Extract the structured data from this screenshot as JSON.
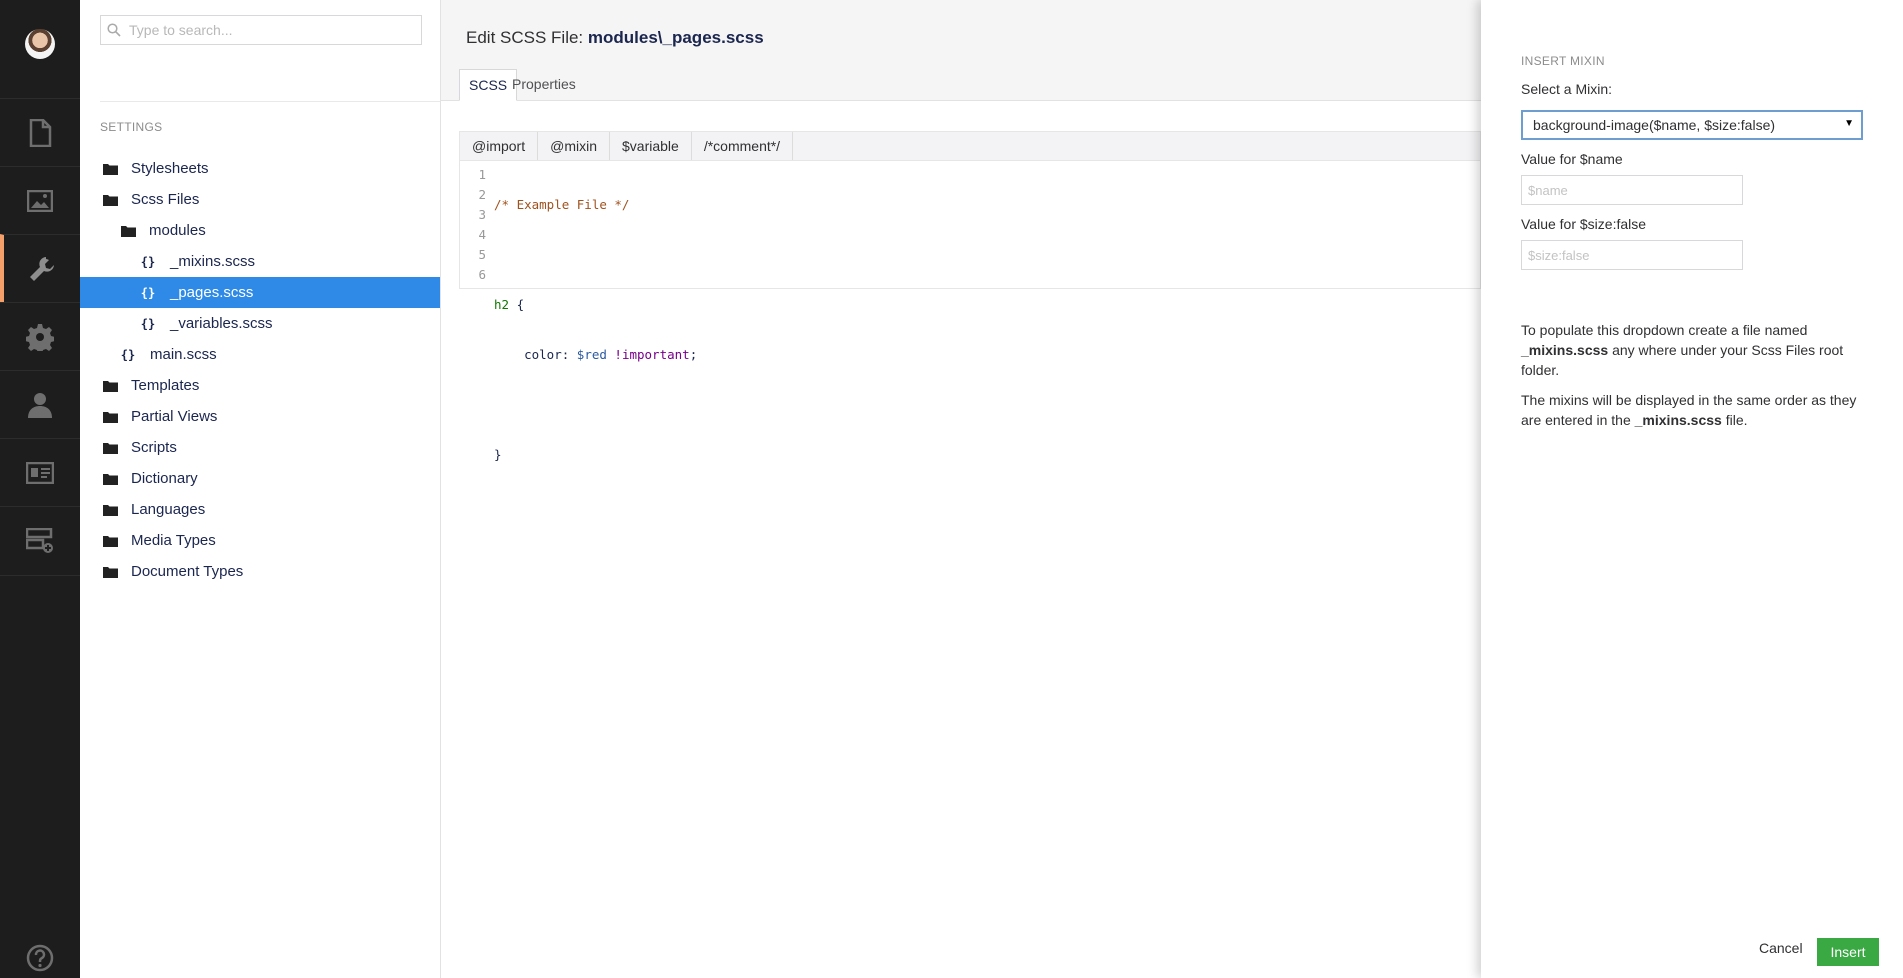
{
  "search": {
    "placeholder": "Type to search..."
  },
  "tree": {
    "section_title": "SETTINGS",
    "nodes": [
      {
        "label": "Stylesheets",
        "type": "folder"
      },
      {
        "label": "Scss Files",
        "type": "folder"
      },
      {
        "label": "modules",
        "type": "folder"
      },
      {
        "label": "_mixins.scss",
        "type": "file"
      },
      {
        "label": "_pages.scss",
        "type": "file",
        "selected": true
      },
      {
        "label": "_variables.scss",
        "type": "file"
      },
      {
        "label": "main.scss",
        "type": "file"
      },
      {
        "label": "Templates",
        "type": "folder"
      },
      {
        "label": "Partial Views",
        "type": "folder"
      },
      {
        "label": "Scripts",
        "type": "folder"
      },
      {
        "label": "Dictionary",
        "type": "folder"
      },
      {
        "label": "Languages",
        "type": "folder"
      },
      {
        "label": "Media Types",
        "type": "folder"
      },
      {
        "label": "Document Types",
        "type": "folder"
      }
    ],
    "brace_glyph": "{}"
  },
  "editor": {
    "title_prefix": "Edit SCSS File:",
    "title_file": "modules\\_pages.scss",
    "tabs": [
      "SCSS",
      "Properties"
    ],
    "toolbar": [
      "@import",
      "@mixin",
      "$variable",
      "/*comment*/"
    ],
    "line_numbers": [
      "1",
      "2",
      "3",
      "4",
      "5",
      "6"
    ],
    "code": {
      "line1": "/* Example File */",
      "line3_tag": "h2",
      "line3_brace": " {",
      "line4_prop": "    color: ",
      "line4_var": "$red",
      "line4_imp": " !important",
      "line4_end": ";",
      "line6": "}"
    }
  },
  "dialog": {
    "title": "INSERT MIXIN",
    "select_label": "Select a Mixin:",
    "selected_mixin": "background-image($name, $size:false)",
    "field1_label": "Value for $name",
    "field1_placeholder": "$name",
    "field2_label": "Value for $size:false",
    "field2_placeholder": "$size:false",
    "help1_a": "To populate this dropdown create a file named",
    "help1_b": "_mixins.scss",
    "help1_c": "any where under your Scss Files root folder.",
    "help2_a": "The mixins will be displayed in the same order as they are entered in the",
    "help2_b": "_mixins.scss",
    "help2_c": "file.",
    "cancel_label": "Cancel",
    "insert_label": "Insert"
  },
  "colors": {
    "appbar": "#1d1d1d",
    "selection": "#2e8ae6",
    "active_accent": "#f5a06a",
    "insert_button": "#3aa843"
  },
  "appbar_icons": [
    "user-avatar",
    "document-icon",
    "image-icon",
    "wrench-icon",
    "gear-icon",
    "person-icon",
    "id-card-icon",
    "forms-icon",
    "help-icon"
  ]
}
